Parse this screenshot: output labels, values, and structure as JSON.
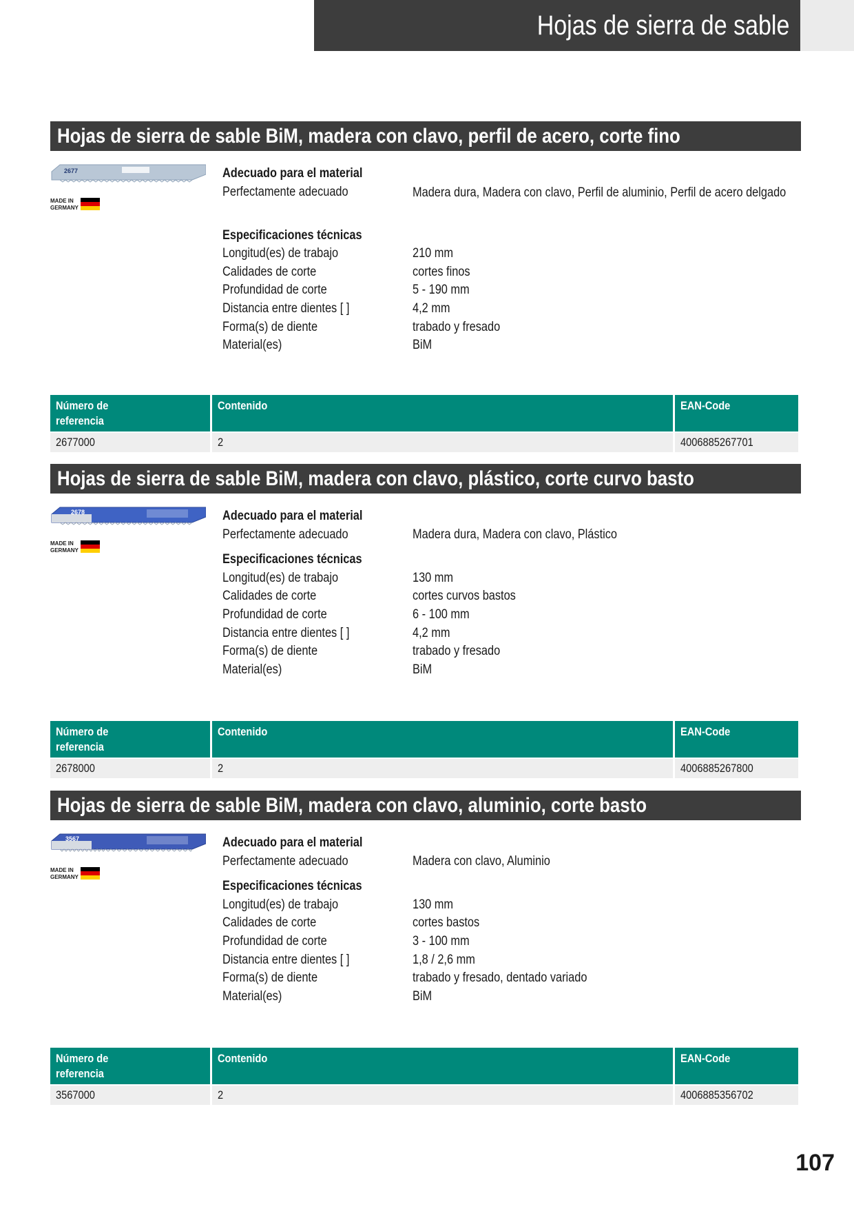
{
  "page_header": "Hojas de sierra de sable",
  "page_number": "107",
  "table_headers": {
    "reference": "Número de referencia",
    "contents": "Contenido",
    "ean": "EAN-Code"
  },
  "sections": [
    {
      "title": "Hojas de sierra de sable BiM, madera con clavo, perfil de acero, corte fino",
      "blade_code": "2677",
      "blade_color": "#b9c7d6",
      "made_in": "MADE IN GERMANY",
      "suitability_heading": "Adecuado para el material",
      "suitability_label": "Perfectamente adecuado",
      "suitability_value": "Madera dura, Madera con clavo, Perfil de aluminio, Perfil de acero delgado",
      "specs_heading": "Especificaciones técnicas",
      "specs": [
        {
          "label": "Longitud(es) de trabajo",
          "value": "210 mm"
        },
        {
          "label": "Calidades de corte",
          "value": "cortes finos"
        },
        {
          "label": "Profundidad de corte",
          "value": "5 - 190 mm"
        },
        {
          "label": "Distancia entre dientes [ ]",
          "value": "4,2 mm"
        },
        {
          "label": "Forma(s) de diente",
          "value": "trabado y fresado"
        },
        {
          "label": "Material(es)",
          "value": "BiM"
        }
      ],
      "row": {
        "reference": "2677000",
        "contents": "2",
        "ean": "4006885267701"
      }
    },
    {
      "title": "Hojas de sierra de sable BiM, madera con clavo, plástico, corte curvo basto",
      "blade_code": "2678",
      "blade_color": "#3f63c4",
      "made_in": "MADE IN GERMANY",
      "suitability_heading": "Adecuado para el material",
      "suitability_label": "Perfectamente adecuado",
      "suitability_value": "Madera dura, Madera con clavo, Plástico",
      "specs_heading": "Especificaciones técnicas",
      "specs": [
        {
          "label": "Longitud(es) de trabajo",
          "value": "130 mm"
        },
        {
          "label": "Calidades de corte",
          "value": "cortes curvos bastos"
        },
        {
          "label": "Profundidad de corte",
          "value": "6 - 100 mm"
        },
        {
          "label": "Distancia entre dientes [ ]",
          "value": "4,2 mm"
        },
        {
          "label": "Forma(s) de diente",
          "value": "trabado y fresado"
        },
        {
          "label": "Material(es)",
          "value": "BiM"
        }
      ],
      "row": {
        "reference": "2678000",
        "contents": "2",
        "ean": "4006885267800"
      }
    },
    {
      "title": "Hojas de sierra de sable BiM, madera con clavo, aluminio, corte basto",
      "blade_code": "3567",
      "blade_color": "#3f5bb8",
      "made_in": "MADE IN GERMANY",
      "suitability_heading": "Adecuado para el material",
      "suitability_label": "Perfectamente adecuado",
      "suitability_value": "Madera con clavo, Aluminio",
      "specs_heading": "Especificaciones técnicas",
      "specs": [
        {
          "label": "Longitud(es) de trabajo",
          "value": "130 mm"
        },
        {
          "label": "Calidades de corte",
          "value": "cortes bastos"
        },
        {
          "label": "Profundidad de corte",
          "value": "3 - 100 mm"
        },
        {
          "label": "Distancia entre dientes [ ]",
          "value": "1,8 / 2,6 mm"
        },
        {
          "label": "Forma(s) de diente",
          "value": "trabado y fresado, dentado variado"
        },
        {
          "label": "Material(es)",
          "value": "BiM"
        }
      ],
      "row": {
        "reference": "3567000",
        "contents": "2",
        "ean": "4006885356702"
      }
    }
  ]
}
